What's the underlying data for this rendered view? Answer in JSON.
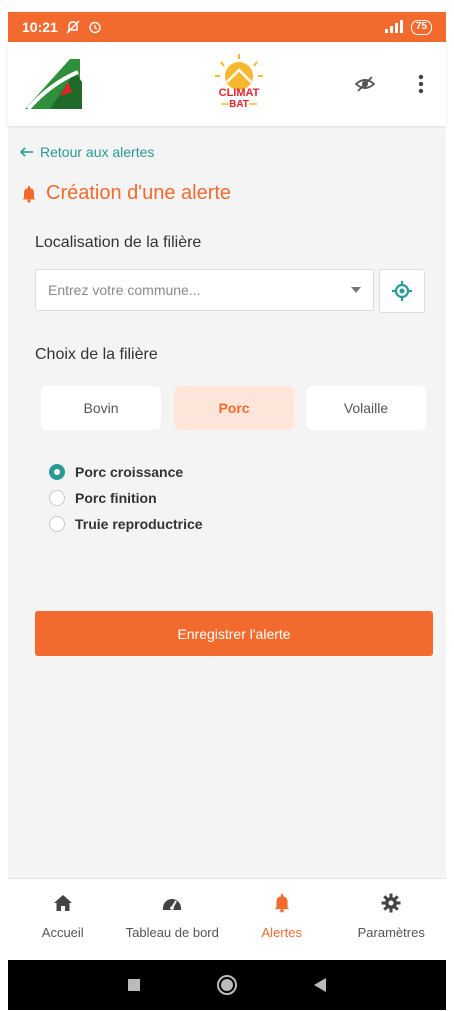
{
  "status": {
    "time": "10:21",
    "battery": "75"
  },
  "header": {
    "center_logo_line1": "CLIMAT",
    "center_logo_line2": "BAT"
  },
  "back_link": "Retour aux alertes",
  "page_title": "Création d'une alerte",
  "location": {
    "label": "Localisation de la filière",
    "placeholder": "Entrez votre commune..."
  },
  "filiere": {
    "label": "Choix de la filière",
    "options": [
      "Bovin",
      "Porc",
      "Volaille"
    ],
    "selected": "Porc"
  },
  "sub_options": [
    {
      "label": "Porc croissance",
      "checked": true
    },
    {
      "label": "Porc finition",
      "checked": false
    },
    {
      "label": "Truie reproductrice",
      "checked": false
    }
  ],
  "save_button": "Enregistrer l'alerte",
  "bottom_nav": [
    {
      "label": "Accueil",
      "icon": "home-icon"
    },
    {
      "label": "Tableau de bord",
      "icon": "dashboard-icon"
    },
    {
      "label": "Alertes",
      "icon": "bell-icon",
      "active": true
    },
    {
      "label": "Paramètres",
      "icon": "gear-icon"
    }
  ],
  "colors": {
    "accent": "#f26a2e",
    "teal": "#2a9a94",
    "selected_bg": "#fde6d9"
  }
}
